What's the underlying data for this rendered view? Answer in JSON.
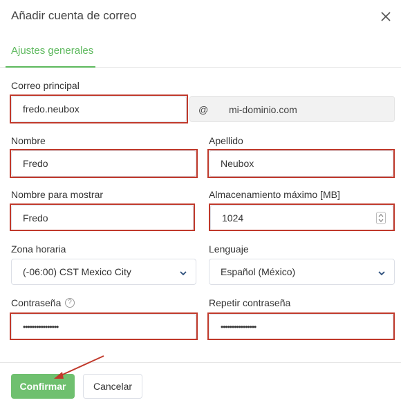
{
  "dialog": {
    "title": "Añadir cuenta de correo",
    "close_icon": "close-icon"
  },
  "tabs": [
    {
      "label": "Ajustes generales",
      "active": true
    }
  ],
  "form": {
    "email": {
      "label": "Correo principal",
      "value": "fredo.neubox",
      "at": "@",
      "domain": "mi-dominio.com"
    },
    "first_name": {
      "label": "Nombre",
      "value": "Fredo"
    },
    "last_name": {
      "label": "Apellido",
      "value": "Neubox"
    },
    "display_name": {
      "label": "Nombre para mostrar",
      "value": "Fredo"
    },
    "max_storage": {
      "label": "Almacenamiento máximo [MB]",
      "value": "1024"
    },
    "timezone": {
      "label": "Zona horaria",
      "value": "(-06:00) CST Mexico City"
    },
    "language": {
      "label": "Lenguaje",
      "value": "Español (México)"
    },
    "password": {
      "label": "Contraseña",
      "value": "••••••••••••••••",
      "help_icon": "help-icon"
    },
    "repeat_password": {
      "label": "Repetir contraseña",
      "value": "••••••••••••••••"
    }
  },
  "buttons": {
    "confirm": "Confirmar",
    "cancel": "Cancelar"
  },
  "colors": {
    "accent_green": "#5cb85c",
    "confirm_button": "#6fc06f",
    "highlight_red": "#c0392b"
  }
}
